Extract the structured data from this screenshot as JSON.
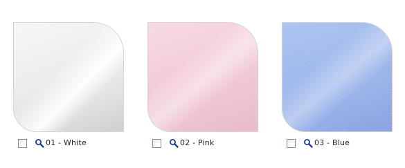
{
  "swatches": [
    {
      "label": "01 - White",
      "color": "#f0f0f0",
      "selected": false,
      "zoom_icon": "magnifier-icon"
    },
    {
      "label": "02 - Pink",
      "color": "#f2cad8",
      "selected": false,
      "zoom_icon": "magnifier-icon"
    },
    {
      "label": "03 - Blue",
      "color": "#9db7ec",
      "selected": false,
      "zoom_icon": "magnifier-icon"
    }
  ],
  "colors": {
    "icon_blue": "#1d3f8f",
    "text": "#222222",
    "border": "#d4d4d4"
  }
}
